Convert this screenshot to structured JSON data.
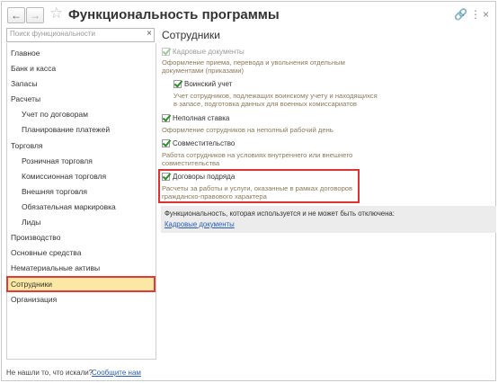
{
  "window": {
    "title": "Функциональность программы"
  },
  "search": {
    "placeholder": "Поиск функциональности",
    "clear_glyph": "×"
  },
  "sidebar": {
    "items": [
      {
        "label": "Главное"
      },
      {
        "label": "Банк и касса"
      },
      {
        "label": "Запасы"
      },
      {
        "label": "Расчеты"
      },
      {
        "label": "Учет по договорам"
      },
      {
        "label": "Планирование платежей"
      },
      {
        "label": "Торговля"
      },
      {
        "label": "Розничная торговля"
      },
      {
        "label": "Комиссионная торговля"
      },
      {
        "label": "Внешняя торговля"
      },
      {
        "label": "Обязательная маркировка"
      },
      {
        "label": "Лиды"
      },
      {
        "label": "Производство"
      },
      {
        "label": "Основные средства"
      },
      {
        "label": "Нематериальные активы"
      },
      {
        "label": "Сотрудники",
        "selected": true
      },
      {
        "label": "Организация"
      }
    ]
  },
  "footer": {
    "text": "Не нашли то, что искали?",
    "link": "Сообщите нам"
  },
  "main": {
    "title": "Сотрудники",
    "options": [
      {
        "label": "Кадровые документы",
        "checked": true,
        "disabled": true,
        "desc": [
          "Оформление приема, перевода и увольнения отдельным",
          "документами (приказами)"
        ]
      },
      {
        "label": "Воинский учет",
        "checked": true,
        "disabled": false,
        "desc": [
          "Учет сотрудников, подлежащих воинскому учету и находящихся",
          "в запасе, подготовка данных для военных комиссариатов"
        ]
      },
      {
        "label": "Неполная ставка",
        "checked": true,
        "disabled": false,
        "desc": [
          "Оформление сотрудников на неполный рабочий день"
        ]
      },
      {
        "label": "Совместительство",
        "checked": true,
        "disabled": false,
        "desc": [
          "Работа сотрудников на условиях внутреннего или внешнего",
          "совместительства"
        ]
      },
      {
        "label": "Договоры подряда",
        "checked": true,
        "disabled": false,
        "desc": [
          "Расчеты за работы и услуги, оказанные в рамках договоров",
          "гражданско-правового характера"
        ]
      }
    ],
    "info_text": "Функциональность, которая используется и не может быть отключена:",
    "info_link": "Кадровые документы"
  },
  "colors": {
    "selected_bg": "#fbe9a3",
    "highlight_border": "#e03a3a",
    "check_color": "#2e8b2e",
    "link_color": "#2a5db0"
  }
}
